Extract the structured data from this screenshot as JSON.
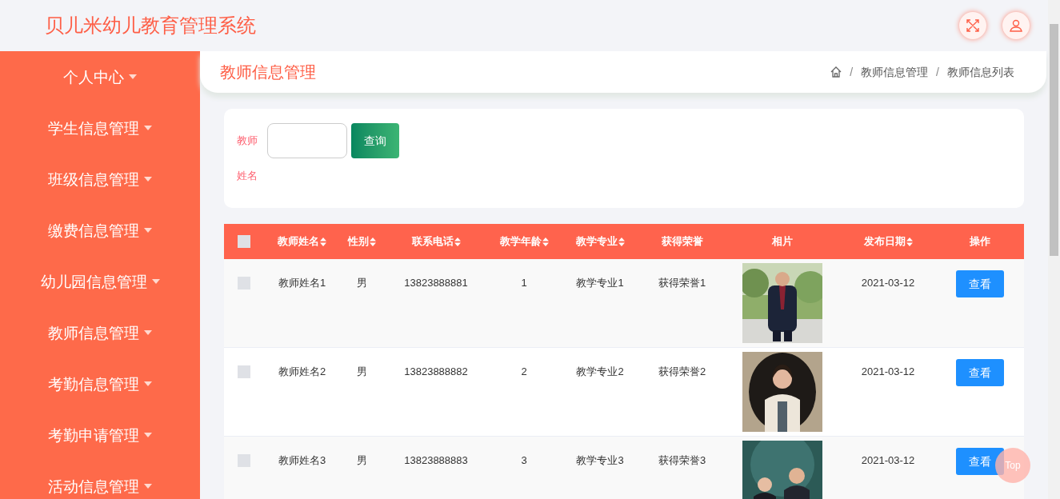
{
  "header": {
    "title": "贝儿米幼儿教育管理系统"
  },
  "sidebar": {
    "items": [
      {
        "label": "个人中心"
      },
      {
        "label": "学生信息管理"
      },
      {
        "label": "班级信息管理"
      },
      {
        "label": "缴费信息管理"
      },
      {
        "label": "幼儿园信息管理"
      },
      {
        "label": "教师信息管理"
      },
      {
        "label": "考勤信息管理"
      },
      {
        "label": "考勤申请管理"
      },
      {
        "label": "活动信息管理"
      }
    ]
  },
  "page": {
    "title": "教师信息管理",
    "breadcrumb": [
      {
        "separator": "/",
        "label": "教师信息管理"
      },
      {
        "separator": "/",
        "label": "教师信息列表"
      }
    ]
  },
  "search": {
    "label": "教师姓名",
    "button": "查询"
  },
  "table": {
    "select_all_checked": false,
    "columns": [
      {
        "label": "教师姓名",
        "sortable": true
      },
      {
        "label": "性别",
        "sortable": true
      },
      {
        "label": "联系电话",
        "sortable": true
      },
      {
        "label": "教学年龄",
        "sortable": true
      },
      {
        "label": "教学专业",
        "sortable": true
      },
      {
        "label": "获得荣誉",
        "sortable": false
      },
      {
        "label": "相片",
        "sortable": false
      },
      {
        "label": "发布日期",
        "sortable": true
      },
      {
        "label": "操作",
        "sortable": false
      }
    ],
    "rows": [
      {
        "checked": false,
        "name": "教师姓名1",
        "gender": "男",
        "phone": "13823888881",
        "age": "1",
        "major": "教学专业1",
        "honor": "获得荣誉1",
        "date": "2021-03-12",
        "action": "查看"
      },
      {
        "checked": false,
        "name": "教师姓名2",
        "gender": "男",
        "phone": "13823888882",
        "age": "2",
        "major": "教学专业2",
        "honor": "获得荣誉2",
        "date": "2021-03-12",
        "action": "查看"
      },
      {
        "checked": false,
        "name": "教师姓名3",
        "gender": "男",
        "phone": "13823888883",
        "age": "3",
        "major": "教学专业3",
        "honor": "获得荣誉3",
        "date": "2021-03-12",
        "action": "查看"
      }
    ]
  },
  "back_to_top": "Top"
}
